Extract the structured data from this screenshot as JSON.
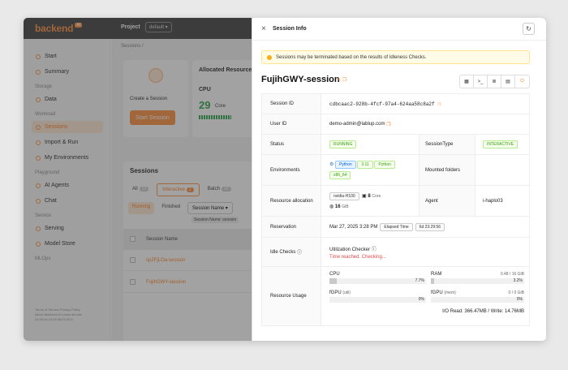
{
  "app": {
    "logo": "backend",
    "logo_badge": "AI",
    "project_label": "Project",
    "project_value": "default",
    "breadcrumb": "Sessions /"
  },
  "sidebar": {
    "items_top": [
      {
        "label": "Start"
      },
      {
        "label": "Summary"
      }
    ],
    "section_storage": "Storage",
    "items_storage": [
      {
        "label": "Data"
      }
    ],
    "section_workload": "Workload",
    "items_workload": [
      {
        "label": "Sessions",
        "active": true
      },
      {
        "label": "Import & Run"
      },
      {
        "label": "My Environments"
      }
    ],
    "section_playground": "Playground",
    "items_playground": [
      {
        "label": "AI Agents"
      },
      {
        "label": "Chat"
      }
    ],
    "section_service": "Service",
    "items_service": [
      {
        "label": "Serving"
      },
      {
        "label": "Model Store"
      }
    ],
    "section_mlops": "MLOps",
    "footer_line1": "Terms of Service  Privacy Policy",
    "footer_line2": "About Backend.AI  Leave service",
    "footer_line3": "24.09.0a  24.09.0b/23.09.0"
  },
  "dashboard": {
    "create_label": "Create a Session",
    "start_button": "Start Session",
    "allocated_title": "Allocated Resources",
    "cpu_label": "CPU",
    "cpu_value": "29",
    "cpu_unit": "Core"
  },
  "sessions_panel": {
    "title": "Sessions",
    "tabs": [
      {
        "label": "All",
        "count": "12"
      },
      {
        "label": "Interactive",
        "count": "2"
      },
      {
        "label": "Batch",
        "count": "10"
      }
    ],
    "sub_tabs": [
      "Running",
      "Finished"
    ],
    "filter_label": "Session Name",
    "filter_chip": "Session Name: session",
    "column_header": "Session Name",
    "rows": [
      "sp2FjLOa-session",
      "FujihGWY-session"
    ]
  },
  "drawer": {
    "title": "Session Info",
    "alert": "Sessions may be terminated based on the results of Idleness Checks.",
    "session_name": "FujihGWY-session",
    "action_buttons": [
      "app-launcher-icon",
      "terminal-icon",
      "log-icon",
      "container-commit-icon",
      "terminate-icon"
    ],
    "rows": {
      "session_id_label": "Session ID",
      "session_id": "cdbcaac2-928b-4fcf-97a4-624aa58c8a2f",
      "user_id_label": "User ID",
      "user_id": "demo-admin@lablup.com",
      "status_label": "Status",
      "status": "RUNNING",
      "session_type_label": "SessionType",
      "session_type": "INTERACTIVE",
      "env_label": "Environments",
      "env_lang": "Python",
      "env_version": "3.11",
      "env_tag": "Python",
      "env_arch": "x86_64",
      "mounted_label": "Mounted folders",
      "alloc_label": "Resource allocation",
      "alloc_accel": "nvidia-H100",
      "alloc_cpu": "8",
      "alloc_cpu_unit": "Core",
      "alloc_mem": "16",
      "alloc_mem_unit": "GiB",
      "agent_label": "Agent",
      "agent": "i-haplo03",
      "reservation_label": "Reservation",
      "reservation": "Mar 27, 2025 3:28 PM",
      "elapsed_label": "Elapsed Time",
      "elapsed": "6d 23:29:56",
      "idle_label": "Idle Checks",
      "idle_checker": "Utilization Checker",
      "idle_status": "Time reached. Checking...",
      "usage_label": "Resource Usage",
      "cpu_label": "CPU",
      "cpu_pct": "7.7%",
      "cpu_fraction": 0.077,
      "ram_label": "RAM",
      "ram_total": "0.48 / 16 GiB",
      "ram_pct": "3.2%",
      "ram_fraction": 0.032,
      "fgpu_util_label": "fGPU",
      "fgpu_util_suffix": "(util)",
      "fgpu_util_pct": "0%",
      "fgpu_util_fraction": 0,
      "fgpu_mem_label": "fGPU",
      "fgpu_mem_suffix": "(mem)",
      "fgpu_mem_total": "0 / 0 GiB",
      "fgpu_mem_pct": "0%",
      "fgpu_mem_fraction": 0,
      "io": "I/O Read: 366.47MB / Write: 14.76MB"
    }
  },
  "colors": {
    "accent": "#ff8c3a",
    "status_green": "#389e0d",
    "topbar": "#3d3d3d"
  }
}
